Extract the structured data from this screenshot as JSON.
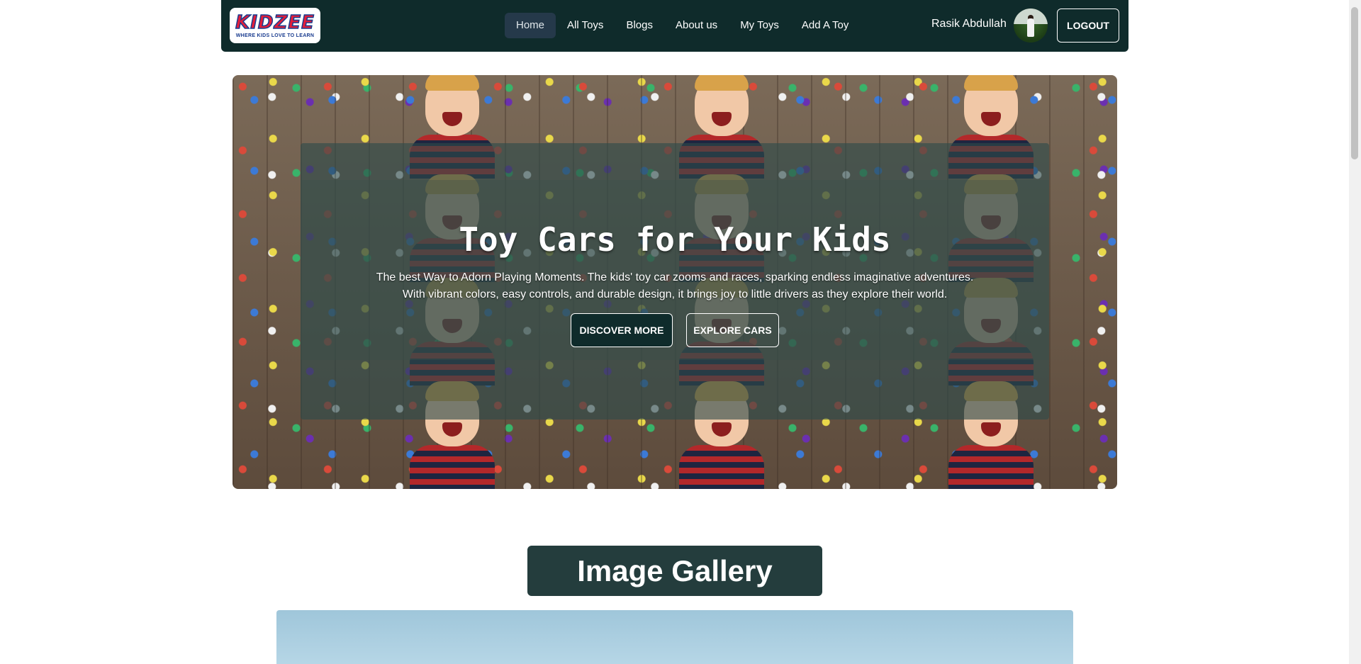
{
  "brand": {
    "logo_text": "KIDZEE",
    "tagline": "WHERE KIDS LOVE TO LEARN"
  },
  "nav": {
    "items": [
      {
        "label": "Home",
        "active": true
      },
      {
        "label": "All Toys"
      },
      {
        "label": "Blogs"
      },
      {
        "label": "About us"
      },
      {
        "label": "My Toys"
      },
      {
        "label": "Add A Toy"
      }
    ]
  },
  "user": {
    "name": "Rasik Abdullah",
    "logout_label": "LOGOUT"
  },
  "hero": {
    "title": "Toy Cars for Your Kids",
    "line1": "The best Way to Adorn Playing Moments. The kids' toy car zooms and races, sparking endless imaginative adventures.",
    "line2": "With vibrant colors, easy controls, and durable design, it brings joy to little drivers as they explore their world.",
    "discover_label": "DISCOVER MORE",
    "explore_label": "EXPLORE CARS"
  },
  "gallery": {
    "title": "Image Gallery"
  },
  "colors": {
    "nav_bg": "#0f2b2b",
    "gallery_title_bg": "#243d3d",
    "accent_red": "#e31e3a"
  }
}
